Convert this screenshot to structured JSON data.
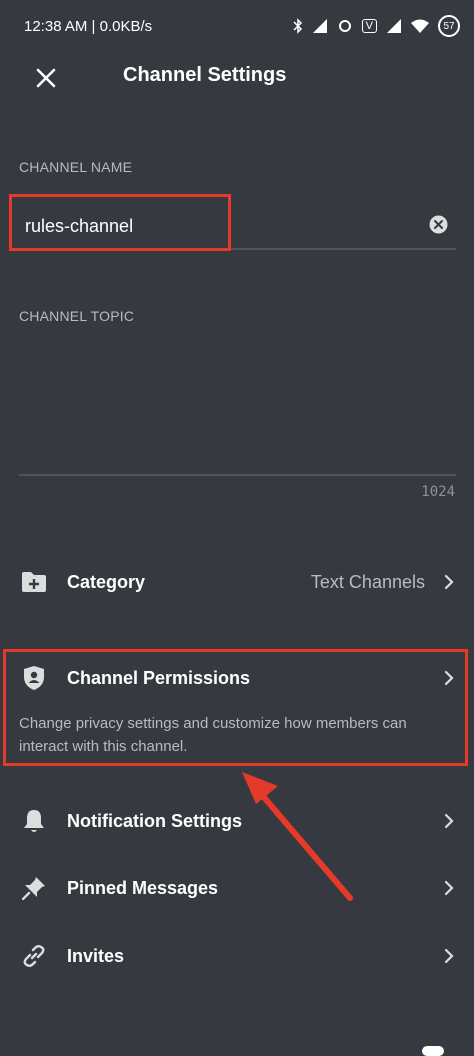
{
  "status_bar": {
    "time_net": "12:38 AM | 0.0KB/s",
    "volte": "V",
    "battery": "57"
  },
  "header": {
    "title": "Channel Settings",
    "close_icon": "close-icon"
  },
  "channel_name": {
    "label": "CHANNEL NAME",
    "value": "rules-channel"
  },
  "channel_topic": {
    "label": "CHANNEL TOPIC",
    "value": "",
    "char_limit": "1024"
  },
  "settings": {
    "category": {
      "label": "Category",
      "value": "Text Channels",
      "icon": "folder-plus-icon"
    },
    "permissions": {
      "label": "Channel Permissions",
      "description": "Change privacy settings and customize how members can interact with this channel.",
      "icon": "shield-user-icon"
    },
    "notifications": {
      "label": "Notification Settings",
      "icon": "bell-icon"
    },
    "pinned": {
      "label": "Pinned Messages",
      "icon": "pin-icon"
    },
    "invites": {
      "label": "Invites",
      "icon": "link-icon"
    }
  },
  "colors": {
    "background": "#36393f",
    "text": "#ffffff",
    "muted": "#b9bbbe",
    "annotation": "#e43a2a"
  }
}
